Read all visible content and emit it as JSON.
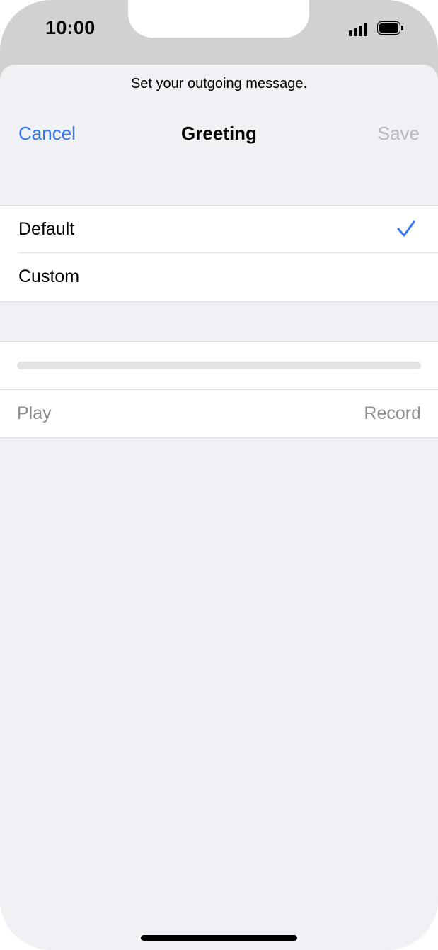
{
  "status_bar": {
    "time": "10:00",
    "signal_icon": "cellular-signal-icon",
    "battery_icon": "battery-full-icon"
  },
  "sheet": {
    "prompt": "Set your outgoing message."
  },
  "nav": {
    "cancel_label": "Cancel",
    "title": "Greeting",
    "save_label": "Save"
  },
  "options": [
    {
      "label": "Default",
      "selected": true
    },
    {
      "label": "Custom",
      "selected": false
    }
  ],
  "player": {
    "progress": 0,
    "play_label": "Play",
    "record_label": "Record"
  },
  "colors": {
    "accent": "#3478f6",
    "disabled_text": "#b8b8bd",
    "secondary_text": "#8e8e93",
    "background": "#f0f0f5"
  }
}
